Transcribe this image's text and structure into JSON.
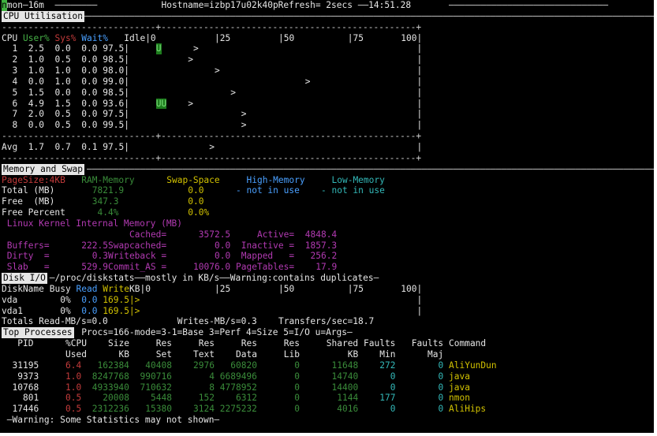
{
  "titlebar": {
    "cursor": "n",
    "left": "mon—16m",
    "center": "Hostname=izbp17u02k40pRefresh= 2secs ——14:51.28"
  },
  "cpu": {
    "section": "CPU Utilisation",
    "head": {
      "cpu": "CPU",
      "user": "User%",
      "sys": "Sys%",
      "wait": "Wait%",
      "idle": "Idle|0",
      "t25": "|25",
      "t50": "|50",
      "t75": "|75",
      "t100": "100|"
    },
    "rows": [
      {
        "id": "1",
        "user": "2.5",
        "sys": "0.0",
        "wait": "0.0",
        "idle": "97.5|",
        "bar": "U",
        "mark": ">"
      },
      {
        "id": "2",
        "user": "1.0",
        "sys": "0.5",
        "wait": "0.0",
        "idle": "98.5|",
        "bar": "",
        "mark": ">"
      },
      {
        "id": "3",
        "user": "1.0",
        "sys": "1.0",
        "wait": "0.0",
        "idle": "98.0|",
        "bar": "",
        "mark": ">"
      },
      {
        "id": "4",
        "user": "0.0",
        "sys": "1.0",
        "wait": "0.0",
        "idle": "99.0|",
        "bar": "",
        "mark": ">"
      },
      {
        "id": "5",
        "user": "1.5",
        "sys": "0.0",
        "wait": "0.0",
        "idle": "98.5|",
        "bar": "",
        "mark": ">"
      },
      {
        "id": "6",
        "user": "4.9",
        "sys": "1.5",
        "wait": "0.0",
        "idle": "93.6|",
        "bar": "UU",
        "mark": ">"
      },
      {
        "id": "7",
        "user": "2.0",
        "sys": "0.5",
        "wait": "0.0",
        "idle": "97.5|",
        "bar": "",
        "mark": ">"
      },
      {
        "id": "8",
        "user": "0.0",
        "sys": "0.5",
        "wait": "0.0",
        "idle": "99.5|",
        "bar": "",
        "mark": ">"
      }
    ],
    "avg": {
      "label": "Avg",
      "user": "1.7",
      "sys": "0.7",
      "wait": "0.1",
      "idle": "97.5|",
      "mark": ">"
    }
  },
  "mem": {
    "section": "Memory and Swap",
    "pagesize": "PageSize:4KB",
    "cols": {
      "ram": "RAM-Memory",
      "swap": "Swap-Space",
      "high": "High-Memory",
      "low": "Low-Memory"
    },
    "total": {
      "label": "Total (MB)",
      "ram": "7821.9",
      "swap": "0.0",
      "high": "- not in use",
      "low": "- not in use"
    },
    "free": {
      "label": "Free  (MB)",
      "ram": "347.3",
      "swap": "0.0"
    },
    "pct": {
      "label": "Free Percent",
      "ram": "4.4%",
      "swap": "0.0%"
    },
    "kernel": "Linux Kernel Internal Memory (MB)",
    "k": [
      {
        "l1": "",
        "v1": "",
        "l2": "Cached=",
        "v2": "3572.5",
        "l3": "Active=",
        "v3": "4848.4"
      },
      {
        "l1": "Buffers=",
        "v1": "222.5",
        "l2": "Swapcached=",
        "v2": "0.0",
        "l3": "Inactive =",
        "v3": "1857.3"
      },
      {
        "l1": "Dirty  =",
        "v1": "0.3",
        "l2": "Writeback =",
        "v2": "0.0",
        "l3": "Mapped   =",
        "v3": "256.2"
      },
      {
        "l1": "Slab   =",
        "v1": "529.9",
        "l2": "Commit_AS =",
        "v2": "10076.0",
        "l3": "PageTables=",
        "v3": "17.9"
      }
    ]
  },
  "disk": {
    "section": "Disk I/O",
    "info": "—/proc/diskstats——mostly in KB/s——Warning:contains duplicates—",
    "head": {
      "name": "DiskName",
      "busy": "Busy",
      "read": "Read",
      "write": "Write",
      "kb": "KB|0",
      "t25": "|25",
      "t50": "|50",
      "t75": "|75",
      "t100": "100|"
    },
    "rows": [
      {
        "name": "vda",
        "busy": "0%",
        "read": "0.0",
        "write": "169.5|>"
      },
      {
        "name": "vda1",
        "busy": "0%",
        "read": "0.0",
        "write": "169.5|>"
      }
    ],
    "totals": {
      "read": "Totals Read-MB/s=0.0",
      "write": "Writes-MB/s=0.3",
      "xfer": "Transfers/sec=18.7"
    }
  },
  "top": {
    "section": "Top Processes",
    "info": "Procs=166-mode=3-1=Base 3=Perf 4=Size 5=I/O u=Args—",
    "h1": [
      "PID",
      "%CPU",
      "Size",
      "Res",
      "Res",
      "Res",
      "Res",
      "Shared",
      "Faults",
      "Faults",
      "Command"
    ],
    "h2": [
      "",
      "Used",
      "KB",
      "Set",
      "Text",
      "Data",
      "Lib",
      "KB",
      "Min",
      "Maj",
      ""
    ],
    "rows": [
      {
        "pid": "31195",
        "cpu": "6.4",
        "size": "162384",
        "set": "40408",
        "text": "2976",
        "data": "60820",
        "lib": "0",
        "shared": "11648",
        "min": "272",
        "maj": "0",
        "cmd": "AliYunDun"
      },
      {
        "pid": "9373",
        "cpu": "1.0",
        "size": "8247768",
        "set": "990716",
        "text": "4",
        "data": "6689496",
        "lib": "0",
        "shared": "14740",
        "min": "0",
        "maj": "0",
        "cmd": "java"
      },
      {
        "pid": "10768",
        "cpu": "1.0",
        "size": "4933940",
        "set": "710632",
        "text": "8",
        "data": "4778952",
        "lib": "0",
        "shared": "14400",
        "min": "0",
        "maj": "0",
        "cmd": "java"
      },
      {
        "pid": "801",
        "cpu": "0.5",
        "size": "20008",
        "set": "5448",
        "text": "152",
        "data": "6312",
        "lib": "0",
        "shared": "1144",
        "min": "177",
        "maj": "0",
        "cmd": "nmon"
      },
      {
        "pid": "17446",
        "cpu": "0.5",
        "size": "2312236",
        "set": "15380",
        "text": "3124",
        "data": "2275232",
        "lib": "0",
        "shared": "4016",
        "min": "0",
        "maj": "0",
        "cmd": "AliHips"
      }
    ]
  },
  "footer": "—Warning: Some Statistics may not shown—"
}
